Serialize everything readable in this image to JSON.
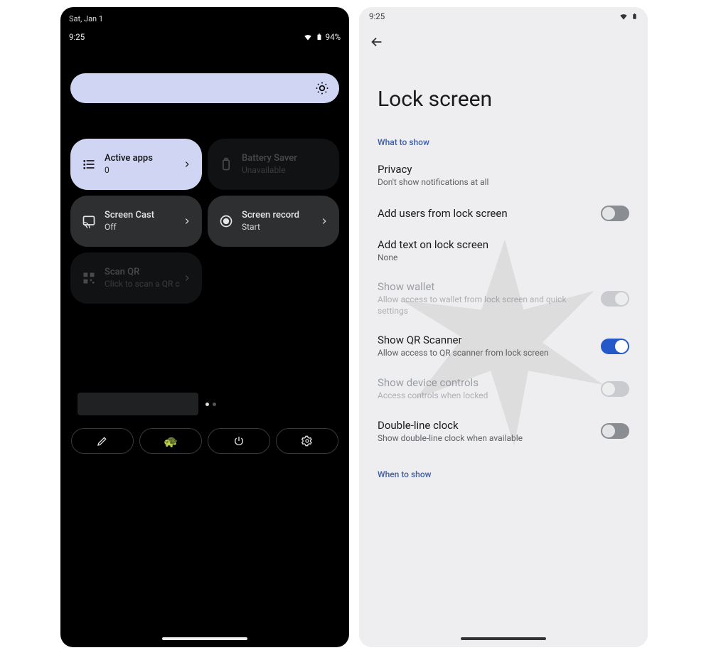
{
  "left": {
    "date": "Sat, Jan 1",
    "time": "9:25",
    "battery": "94%",
    "tiles": [
      {
        "icon": "list-icon",
        "title": "Active apps",
        "sub": "0",
        "style": "active"
      },
      {
        "icon": "battery-icon",
        "title": "Battery Saver",
        "sub": "Unavailable",
        "style": "dim"
      },
      {
        "icon": "cast-icon",
        "title": "Screen Cast",
        "sub": "Off",
        "style": "mid"
      },
      {
        "icon": "record-icon",
        "title": "Screen record",
        "sub": "Start",
        "style": "mid"
      },
      {
        "icon": "qr-icon",
        "title": "Scan QR",
        "sub": "Click to scan a QR c",
        "style": "dim"
      }
    ],
    "actions": [
      {
        "icon": "pencil-icon"
      },
      {
        "icon": "user-emoji"
      },
      {
        "icon": "power-icon"
      },
      {
        "icon": "settings-icon"
      }
    ]
  },
  "right": {
    "time": "9:25",
    "title": "Lock screen",
    "section1": "What to show",
    "section2": "When to show",
    "items": [
      {
        "title": "Privacy",
        "sub": "Don't show notifications at all",
        "toggle": null
      },
      {
        "title": "Add users from lock screen",
        "sub": "",
        "toggle": "off"
      },
      {
        "title": "Add text on lock screen",
        "sub": "None",
        "toggle": null
      },
      {
        "title": "Show wallet",
        "sub": "Allow access to wallet from lock screen and quick settings",
        "toggle": "on-disabled",
        "disabled": true
      },
      {
        "title": "Show QR Scanner",
        "sub": "Allow access to QR scanner from lock screen",
        "toggle": "on"
      },
      {
        "title": "Show device controls",
        "sub": "Access controls when locked",
        "toggle": "off-disabled",
        "disabled": true
      },
      {
        "title": "Double-line clock",
        "sub": "Show double-line clock when available",
        "toggle": "off"
      }
    ]
  }
}
